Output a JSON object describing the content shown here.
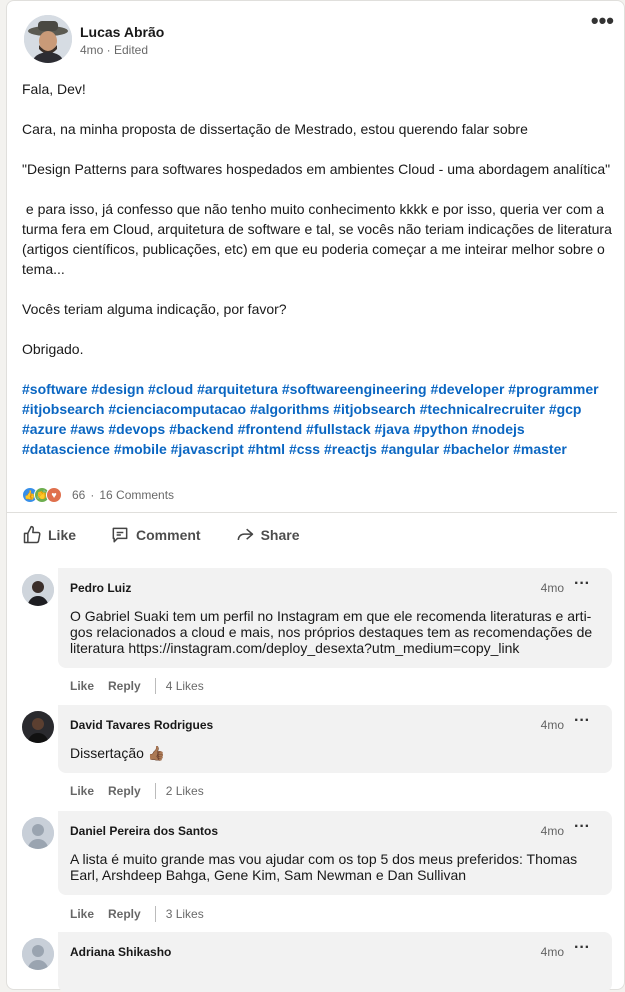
{
  "post": {
    "author_name": "Lucas Abrão",
    "author_meta": "4mo · Edited",
    "more_icon": "more-dots-icon",
    "paragraphs": [
      "Fala, Dev!",
      "Cara, na minha proposta de dissertação de Mestrado, estou querendo falar sobre",
      "\"Design Patterns para softwares hospedados em ambientes Cloud - uma abordagem analítica\"",
      " e para isso, já confesso que não tenho muito conhecimento kkkk e por isso, queria ver com a turma fera em Cloud, arquitetura de software e tal, se vocês não teriam indicações de literatura (artigos científicos, publicações, etc) em que eu poderia começar a me inteirar melhor sobre o tema...",
      "Vocês teriam alguma indicação, por favor?",
      "Obrigado."
    ],
    "hashtags": [
      "#software",
      "#design",
      "#cloud",
      "#arquitetura",
      "#softwareengineering",
      "#developer",
      "#programmer",
      "#itjobsearch",
      "#cienciacomputacao",
      "#algorithms",
      "#itjobsearch",
      "#technicalrecruiter",
      "#gcp",
      "#azure",
      "#aws",
      "#devops",
      "#backend",
      "#frontend",
      "#fullstack",
      "#java",
      "#python",
      "#nodejs",
      "#datascience",
      "#mobile",
      "#javascript",
      "#html",
      "#css",
      "#reactjs",
      "#angular",
      "#bachelor",
      "#master"
    ]
  },
  "social": {
    "reactions_count": "66",
    "separator": "·",
    "comments_count": "16 Comments",
    "reaction_icons": [
      "like-reaction-icon",
      "celebrate-reaction-icon",
      "love-reaction-icon"
    ]
  },
  "actions": {
    "like": "Like",
    "comment": "Comment",
    "share": "Share"
  },
  "comments": [
    {
      "name": "Pedro Luiz",
      "time": "4mo",
      "text": "O Gabriel Suaki tem um perfil no Instagram em que ele recomenda literaturas e arti-gos relacionados a cloud e mais, nos próprios destaques tem as recomendações de literatura https://instagram.com/deploy_desexta?utm_medium=copy_link",
      "like": "Like",
      "reply": "Reply",
      "likes": "4 Likes"
    },
    {
      "name": "David Tavares Rodrigues",
      "time": "4mo",
      "text": "Dissertação 👍🏾",
      "like": "Like",
      "reply": "Reply",
      "likes": "2 Likes"
    },
    {
      "name": "Daniel Pereira dos Santos",
      "time": "4mo",
      "text": "A lista é muito grande mas vou ajudar com os top 5 dos meus preferidos: Thomas Earl, Arshdeep Bahga, Gene Kim, Sam Newman e Dan Sullivan",
      "like": "Like",
      "reply": "Reply",
      "likes": "3 Likes"
    },
    {
      "name": "Adriana Shikasho",
      "time": "4mo",
      "text": "",
      "like": "",
      "reply": "",
      "likes": ""
    }
  ],
  "colors": {
    "link": "#0a66c2",
    "bubble": "#f2f2f2",
    "like_reaction": "#378fe9",
    "celebrate_reaction": "#6dae4f",
    "love_reaction": "#df704d"
  }
}
